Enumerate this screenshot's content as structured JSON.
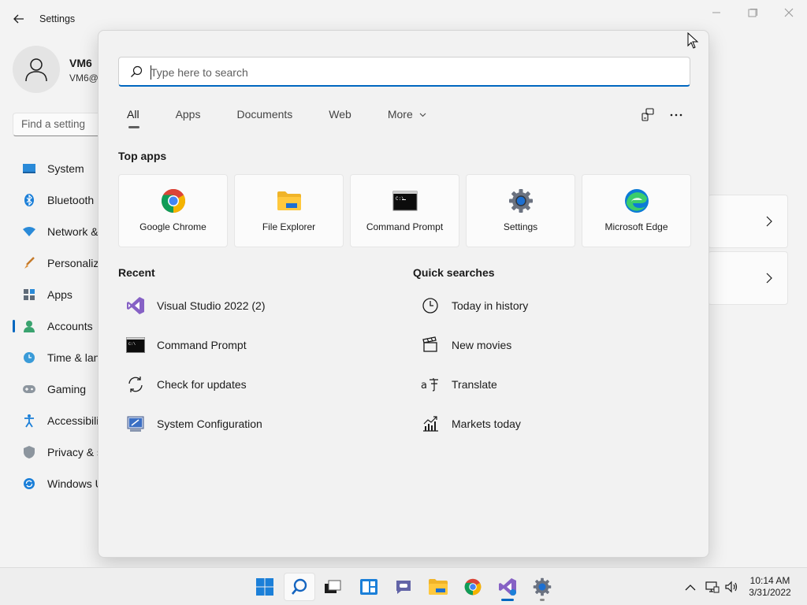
{
  "window": {
    "title": "Settings",
    "back_icon": "back-arrow-icon",
    "controls": [
      "minimize",
      "maximize",
      "close"
    ]
  },
  "profile": {
    "name": "VM6",
    "email": "VM6@"
  },
  "find_setting": {
    "placeholder": "Find a setting"
  },
  "sidebar": {
    "items": [
      {
        "label": "System",
        "icon": "system-icon"
      },
      {
        "label": "Bluetooth",
        "icon": "bluetooth-icon"
      },
      {
        "label": "Network &",
        "icon": "network-icon"
      },
      {
        "label": "Personaliza",
        "icon": "personalization-icon"
      },
      {
        "label": "Apps",
        "icon": "apps-icon"
      },
      {
        "label": "Accounts",
        "icon": "accounts-icon",
        "active": true
      },
      {
        "label": "Time & lan",
        "icon": "time-language-icon"
      },
      {
        "label": "Gaming",
        "icon": "gaming-icon"
      },
      {
        "label": "Accessibilit",
        "icon": "accessibility-icon"
      },
      {
        "label": "Privacy & s",
        "icon": "privacy-icon"
      },
      {
        "label": "Windows U",
        "icon": "windows-update-icon"
      }
    ]
  },
  "search": {
    "placeholder": "Type here to search",
    "value": "",
    "tabs": [
      {
        "label": "All",
        "active": true
      },
      {
        "label": "Apps"
      },
      {
        "label": "Documents"
      },
      {
        "label": "Web"
      },
      {
        "label": "More"
      }
    ],
    "top_apps_heading": "Top apps",
    "top_apps": [
      {
        "label": "Google Chrome",
        "icon": "chrome-icon"
      },
      {
        "label": "File Explorer",
        "icon": "folder-icon"
      },
      {
        "label": "Command Prompt",
        "icon": "cmd-icon"
      },
      {
        "label": "Settings",
        "icon": "gear-icon"
      },
      {
        "label": "Microsoft Edge",
        "icon": "edge-icon"
      }
    ],
    "recent_heading": "Recent",
    "recent": [
      {
        "label": "Visual Studio 2022 (2)",
        "icon": "visual-studio-icon"
      },
      {
        "label": "Command Prompt",
        "icon": "cmd-icon"
      },
      {
        "label": "Check for updates",
        "icon": "refresh-icon"
      },
      {
        "label": "System Configuration",
        "icon": "system-configuration-icon"
      }
    ],
    "quick_heading": "Quick searches",
    "quick": [
      {
        "label": "Today in history",
        "icon": "clock-icon"
      },
      {
        "label": "New movies",
        "icon": "clapperboard-icon"
      },
      {
        "label": "Translate",
        "icon": "translate-icon"
      },
      {
        "label": "Markets today",
        "icon": "chart-icon"
      }
    ]
  },
  "taskbar": {
    "apps": [
      "start",
      "search",
      "task-view",
      "widgets",
      "chat",
      "file-explorer",
      "chrome",
      "visual-studio",
      "settings"
    ],
    "clock": {
      "time": "10:14 AM",
      "date": "3/31/2022"
    }
  },
  "colors": {
    "accent": "#0067c0"
  }
}
